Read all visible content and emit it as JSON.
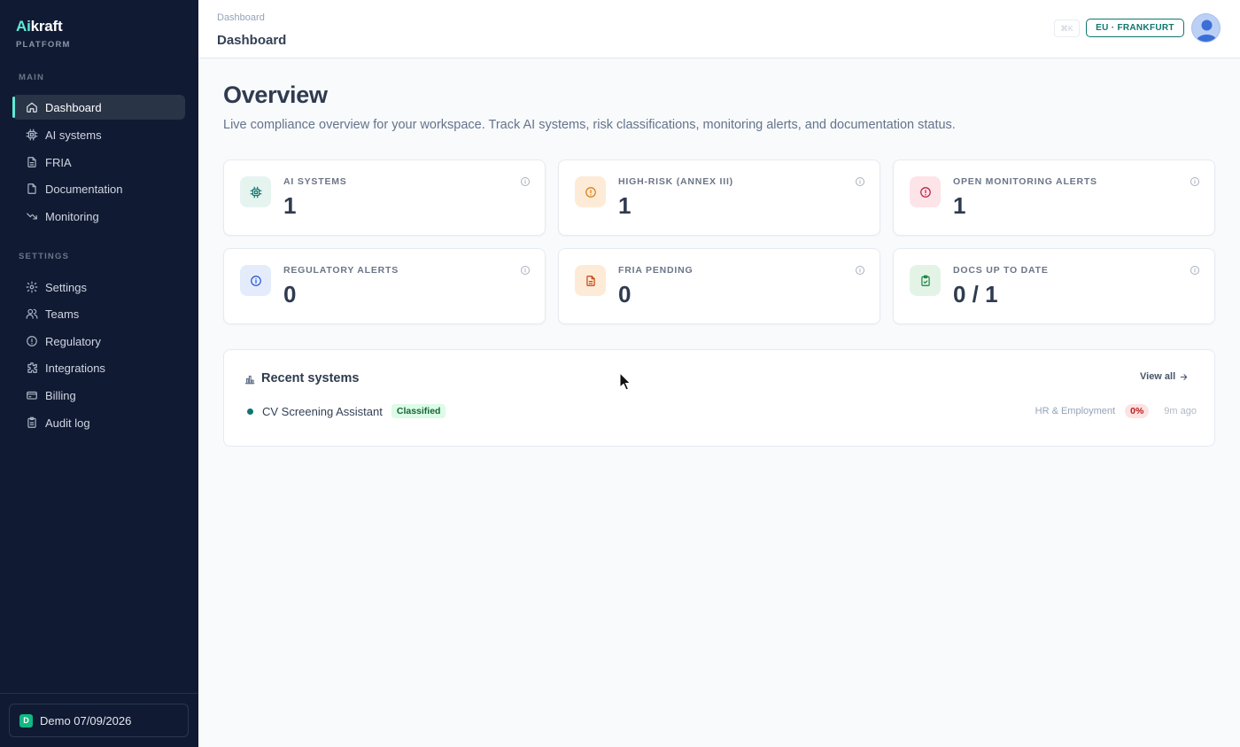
{
  "app": {
    "brand_ai": "Ai",
    "brand_rest": "kraft",
    "brand_sub": "PLATFORM"
  },
  "sidebar": {
    "section_main": "MAIN",
    "section_settings": "SETTINGS",
    "main_items": [
      {
        "label": "Dashboard",
        "icon": "home-icon",
        "active": true
      },
      {
        "label": "AI systems",
        "icon": "chip-icon"
      },
      {
        "label": "FRIA",
        "icon": "document-icon"
      },
      {
        "label": "Documentation",
        "icon": "file-icon"
      },
      {
        "label": "Monitoring",
        "icon": "trend-down-icon"
      }
    ],
    "settings_items": [
      {
        "label": "Settings",
        "icon": "gear-icon"
      },
      {
        "label": "Teams",
        "icon": "users-icon"
      },
      {
        "label": "Regulatory",
        "icon": "alert-circle-icon"
      },
      {
        "label": "Integrations",
        "icon": "puzzle-icon"
      },
      {
        "label": "Billing",
        "icon": "credit-card-icon"
      },
      {
        "label": "Audit log",
        "icon": "clipboard-icon"
      }
    ],
    "workspace": {
      "badge": "D",
      "name": "Demo 07/09/2026"
    }
  },
  "topbar": {
    "breadcrumb": "Dashboard",
    "title": "Dashboard",
    "shortcut": "⌘K",
    "region": "EU · FRANKFURT"
  },
  "main": {
    "heading": "Overview",
    "description": "Live compliance overview for your workspace. Track AI systems, risk classifications, monitoring alerts, and documentation status."
  },
  "stats": [
    {
      "label": "AI SYSTEMS",
      "value": "1",
      "icon": "chip-icon",
      "accent": "#0f766e",
      "bg": "#e6f4f0"
    },
    {
      "label": "HIGH-RISK (ANNEX III)",
      "value": "1",
      "icon": "alert-circle-icon",
      "accent": "#d97706",
      "bg": "#fdebd7"
    },
    {
      "label": "OPEN MONITORING ALERTS",
      "value": "1",
      "icon": "alert-circle-icon",
      "accent": "#be123c",
      "bg": "#fde4e8"
    },
    {
      "label": "REGULATORY ALERTS",
      "value": "0",
      "icon": "info-icon",
      "accent": "#1d4ed8",
      "bg": "#e4ecfb"
    },
    {
      "label": "FRIA PENDING",
      "value": "0",
      "icon": "document-icon",
      "accent": "#c2410c",
      "bg": "#fdebd7"
    },
    {
      "label": "DOCS UP TO DATE",
      "value": "0 / 1",
      "icon": "clipboard-check-icon",
      "accent": "#15803d",
      "bg": "#e3f4e6"
    }
  ],
  "recent": {
    "title": "Recent systems",
    "view_all": "View all",
    "items": [
      {
        "name": "CV Screening Assistant",
        "status": "Classified",
        "sector": "HR & Employment",
        "score": "0%",
        "time": "9m ago"
      }
    ]
  }
}
